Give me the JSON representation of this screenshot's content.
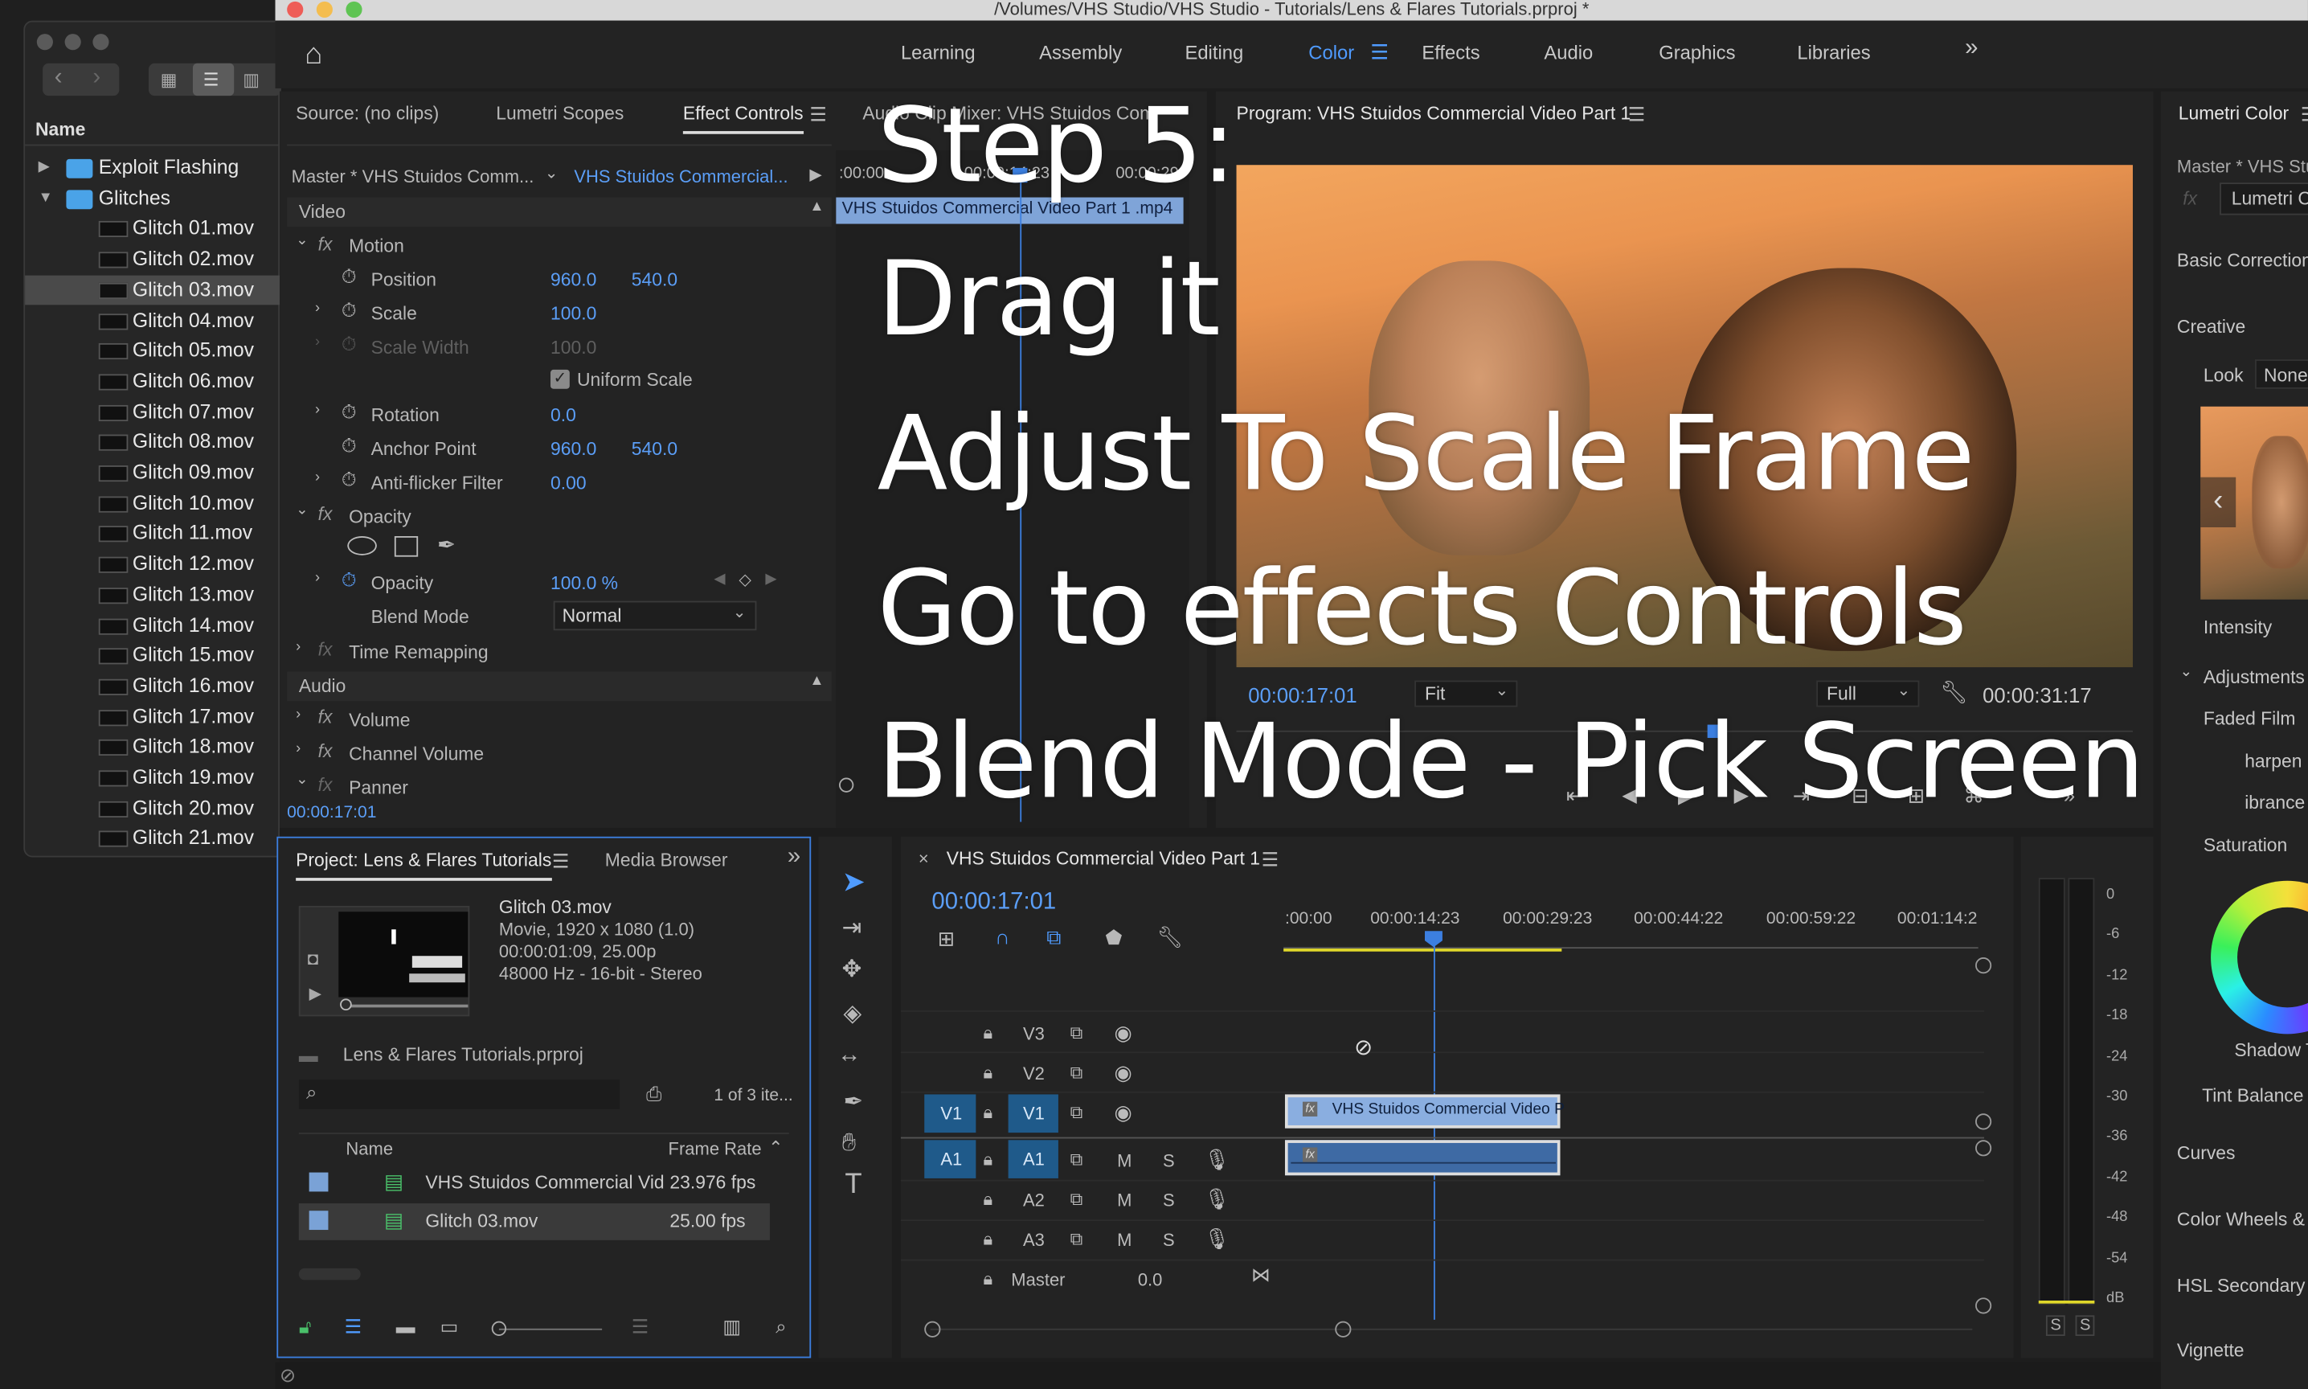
{
  "title_bar": {
    "title": "/Volumes/VHS Studio/VHS Studio - Tutorials/Lens & Flares Tutorials.prproj *"
  },
  "workspaces": {
    "items": [
      "Learning",
      "Assembly",
      "Editing",
      "Color",
      "Effects",
      "Audio",
      "Graphics",
      "Libraries"
    ],
    "active": "Color",
    "more": "»"
  },
  "finder": {
    "header": "Name",
    "folders": [
      "Exploit Flashing",
      "Glitches"
    ],
    "files": [
      "Glitch 01.mov",
      "Glitch 02.mov",
      "Glitch 03.mov",
      "Glitch 04.mov",
      "Glitch 05.mov",
      "Glitch 06.mov",
      "Glitch 07.mov",
      "Glitch 08.mov",
      "Glitch 09.mov",
      "Glitch 10.mov",
      "Glitch 11.mov",
      "Glitch 12.mov",
      "Glitch 13.mov",
      "Glitch 14.mov",
      "Glitch 15.mov",
      "Glitch 16.mov",
      "Glitch 17.mov",
      "Glitch 18.mov",
      "Glitch 19.mov",
      "Glitch 20.mov",
      "Glitch 21.mov"
    ],
    "selected": "Glitch 03.mov"
  },
  "source_panel": {
    "tabs": [
      "Source: (no clips)",
      "Lumetri Scopes",
      "Effect Controls",
      "Audio Clip Mixer: VHS Stuidos Comr"
    ],
    "active_tab": "Effect Controls",
    "master_label": "Master * VHS Stuidos Comm...",
    "clip_label": "VHS Stuidos Commercial...",
    "mini_timecodes": [
      ":00:00",
      "00:00:14:23",
      "00:00:29"
    ],
    "mini_clip": "VHS Stuidos Commercial Video Part 1 .mp4",
    "section_video": "Video",
    "motion": "Motion",
    "position": {
      "label": "Position",
      "x": "960.0",
      "y": "540.0"
    },
    "scale": {
      "label": "Scale",
      "value": "100.0"
    },
    "scale_width": {
      "label": "Scale Width",
      "value": "100.0"
    },
    "uniform_scale": "Uniform Scale",
    "rotation": {
      "label": "Rotation",
      "value": "0.0"
    },
    "anchor": {
      "label": "Anchor Point",
      "x": "960.0",
      "y": "540.0"
    },
    "antiflicker": {
      "label": "Anti-flicker Filter",
      "value": "0.00"
    },
    "opacity_group": "Opacity",
    "opacity": {
      "label": "Opacity",
      "value": "100.0 %"
    },
    "blend_mode": {
      "label": "Blend Mode",
      "value": "Normal"
    },
    "time_remap": "Time Remapping",
    "section_audio": "Audio",
    "volume": "Volume",
    "channel_volume": "Channel Volume",
    "panner": "Panner",
    "timecode": "00:00:17:01"
  },
  "program": {
    "title": "Program: VHS Stuidos Commercial Video Part 1",
    "timecode": "00:00:17:01",
    "fit": "Fit",
    "quality": "Full",
    "duration": "00:00:31:17"
  },
  "overlay": {
    "lines": [
      "Step 5:",
      "Drag it",
      "Adjust To Scale Frame",
      "Go to effects Controls",
      "Blend Mode - Pick Screen"
    ]
  },
  "lumetri": {
    "title": "Lumetri Color",
    "master": "Master * VHS Stu",
    "fx": "Lumetri C",
    "basic": "Basic Correction",
    "creative": "Creative",
    "look_label": "Look",
    "look_value": "None",
    "intensity": "Intensity",
    "adjustments": "Adjustments",
    "faded_film": "Faded Film",
    "sharpen": "harpen",
    "vibrance": "ibrance",
    "saturation": "Saturation",
    "shadow": "Shadow T",
    "tint": "Tint Balance",
    "curves": "Curves",
    "wheels": "Color Wheels & I",
    "hsl": "HSL Secondary",
    "vignette": "Vignette"
  },
  "project": {
    "tabs": [
      "Project: Lens & Flares Tutorials",
      "Media Browser"
    ],
    "clip_name": "Glitch 03.mov",
    "clip_info": [
      "Movie, 1920 x 1080 (1.0)",
      "00:00:01:09, 25.00p",
      "48000 Hz - 16-bit - Stereo"
    ],
    "project_file": "Lens & Flares Tutorials.prproj",
    "count": "1 of 3 ite...",
    "col_name": "Name",
    "col_rate": "Frame Rate",
    "items": [
      {
        "name": "VHS Stuidos Commercial Vid",
        "rate": "23.976 fps"
      },
      {
        "name": "Glitch 03.mov",
        "rate": "25.00 fps"
      }
    ]
  },
  "timeline": {
    "title": "VHS Stuidos Commercial Video Part 1",
    "timecode": "00:00:17:01",
    "ruler": [
      ":00:00",
      "00:00:14:23",
      "00:00:29:23",
      "00:00:44:22",
      "00:00:59:22",
      "00:01:14:2"
    ],
    "video_tracks": [
      "V3",
      "V2",
      "V1"
    ],
    "audio_tracks": [
      "A1",
      "A2",
      "A3"
    ],
    "src_v": "V1",
    "src_a": "A1",
    "master": "Master",
    "master_value": "0.0",
    "clip_label": "VHS Stuidos Commercial Video P",
    "m": "M",
    "s": "S"
  },
  "meter": {
    "scale": [
      "0",
      "-6",
      "-12",
      "-18",
      "-24",
      "-30",
      "-36",
      "-42",
      "-48",
      "-54",
      "dB"
    ],
    "solo": "S"
  }
}
